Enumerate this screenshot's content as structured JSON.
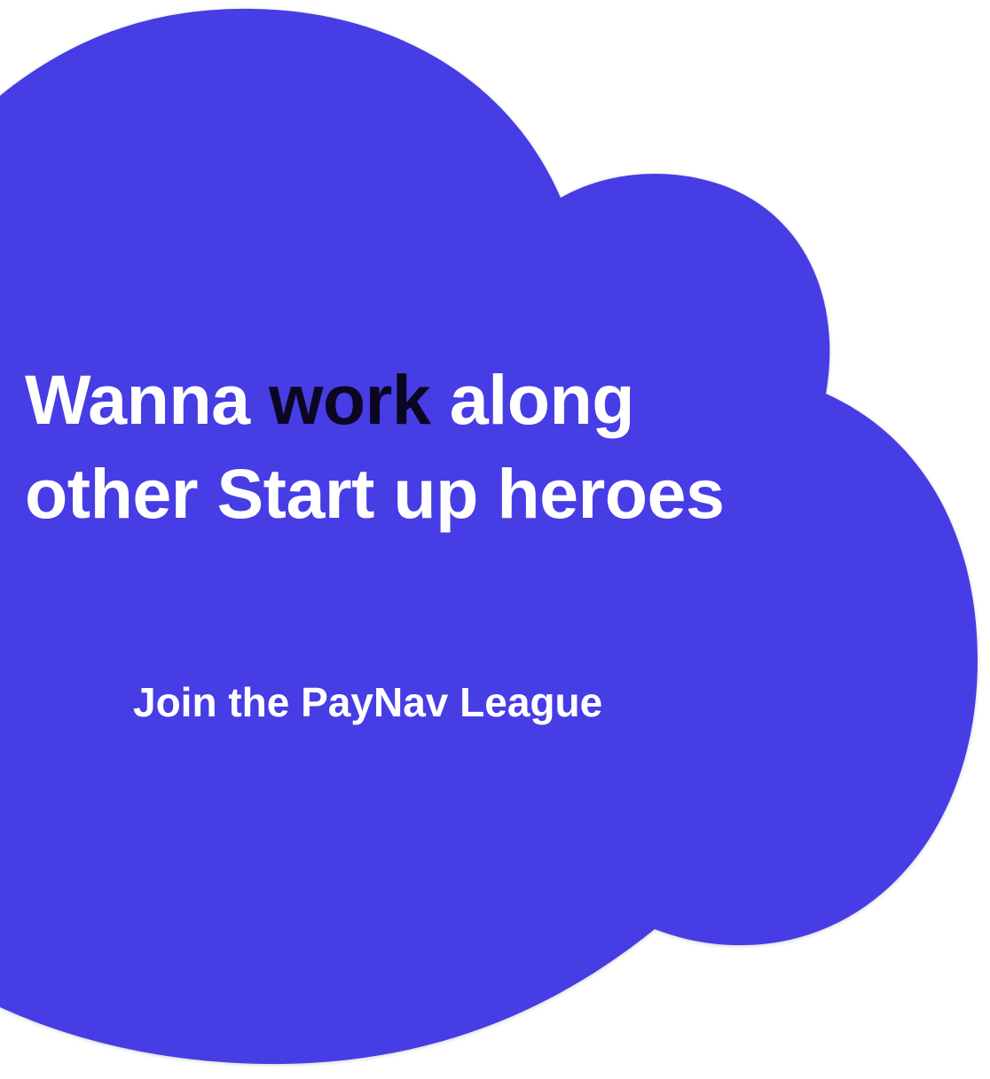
{
  "theme": {
    "cloud_color": "#473EE4",
    "background": "#FFFFFF",
    "text_color": "#FFFFFF",
    "highlight_color": "#0B0722"
  },
  "hero": {
    "headline_part1": "Wanna ",
    "headline_highlight": "work",
    "headline_part2": " along",
    "headline_line2": "other Start up heroes",
    "cta_label": "Join the PayNav League"
  }
}
